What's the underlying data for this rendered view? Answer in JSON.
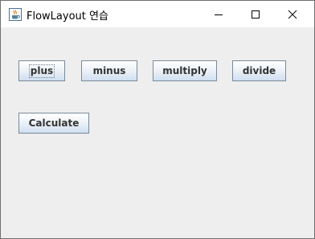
{
  "window": {
    "title": "FlowLayout 연습",
    "icon": "java-coffee-cup-icon",
    "controls": {
      "minimize": "minimize-icon",
      "maximize": "maximize-icon",
      "close": "close-icon"
    }
  },
  "buttons": {
    "plus": "plus",
    "minus": "minus",
    "multiply": "multiply",
    "divide": "divide",
    "calculate": "Calculate"
  },
  "colors": {
    "content_background": "#eeeeee",
    "button_border": "#7a8a99",
    "button_text": "#333333"
  }
}
